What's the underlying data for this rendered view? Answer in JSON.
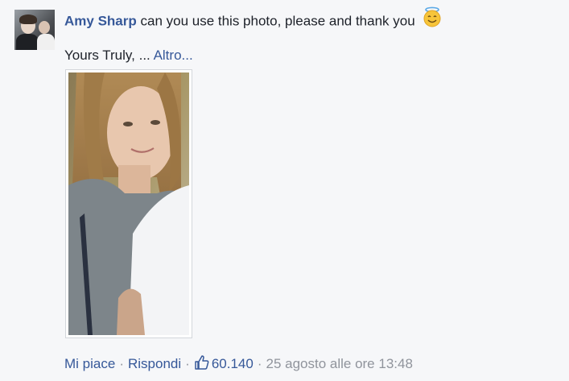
{
  "comment": {
    "author": "Amy Sharp",
    "text": "can you use this photo, please and thank you",
    "emoji_icon": "smiling-face-with-halo",
    "second_line": "Yours Truly, ...",
    "more_link": "Altro..."
  },
  "actions": {
    "like": "Mi piace",
    "reply": "Rispondi",
    "like_icon": "thumbs-up-outline",
    "like_count": "60.140",
    "timestamp": "25 agosto alle ore 13:48",
    "separator": "·"
  },
  "colors": {
    "link": "#365899",
    "text": "#1d2129",
    "meta": "#90949c",
    "background": "#f6f7f9"
  }
}
